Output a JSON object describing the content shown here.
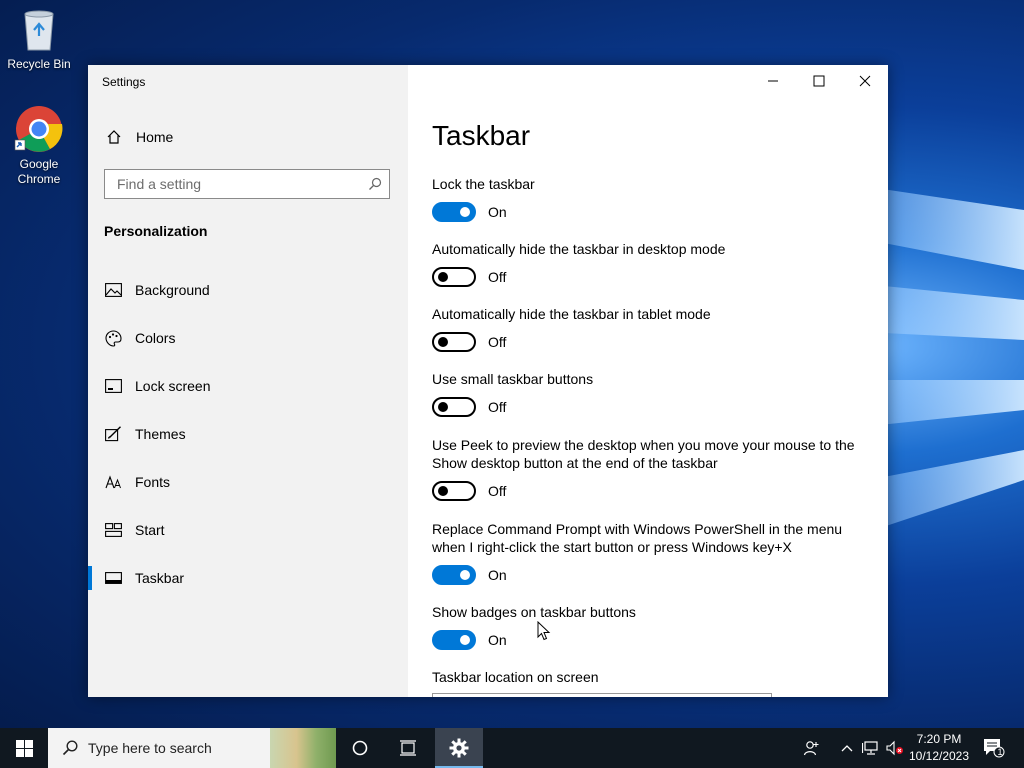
{
  "desktop": {
    "icons": [
      {
        "label": "Recycle Bin"
      },
      {
        "label": "Google Chrome"
      }
    ]
  },
  "window": {
    "title": "Settings",
    "controls": {
      "minimize": "minimize-icon",
      "maximize": "maximize-icon",
      "close": "close-icon"
    }
  },
  "sidebar": {
    "home_label": "Home",
    "search_placeholder": "Find a setting",
    "section_title": "Personalization",
    "items": [
      {
        "label": "Background",
        "icon": "picture-icon"
      },
      {
        "label": "Colors",
        "icon": "palette-icon"
      },
      {
        "label": "Lock screen",
        "icon": "lock-screen-icon"
      },
      {
        "label": "Themes",
        "icon": "brush-icon"
      },
      {
        "label": "Fonts",
        "icon": "font-icon"
      },
      {
        "label": "Start",
        "icon": "start-grid-icon"
      },
      {
        "label": "Taskbar",
        "icon": "taskbar-icon",
        "active": true
      }
    ]
  },
  "main": {
    "title": "Taskbar",
    "settings": [
      {
        "label": "Lock the taskbar",
        "state": "On",
        "on": true
      },
      {
        "label": "Automatically hide the taskbar in desktop mode",
        "state": "Off",
        "on": false
      },
      {
        "label": "Automatically hide the taskbar in tablet mode",
        "state": "Off",
        "on": false
      },
      {
        "label": "Use small taskbar buttons",
        "state": "Off",
        "on": false
      },
      {
        "label": "Use Peek to preview the desktop when you move your mouse to the Show desktop button at the end of the taskbar",
        "state": "Off",
        "on": false
      },
      {
        "label": "Replace Command Prompt with Windows PowerShell in the menu when I right-click the start button or press Windows key+X",
        "state": "On",
        "on": true
      },
      {
        "label": "Show badges on taskbar buttons",
        "state": "On",
        "on": true
      }
    ],
    "location_label": "Taskbar location on screen"
  },
  "taskbar": {
    "search_placeholder": "Type here to search",
    "time": "7:20 PM",
    "date": "10/12/2023",
    "notification_count": "1"
  },
  "colors": {
    "accent": "#0078d7"
  }
}
